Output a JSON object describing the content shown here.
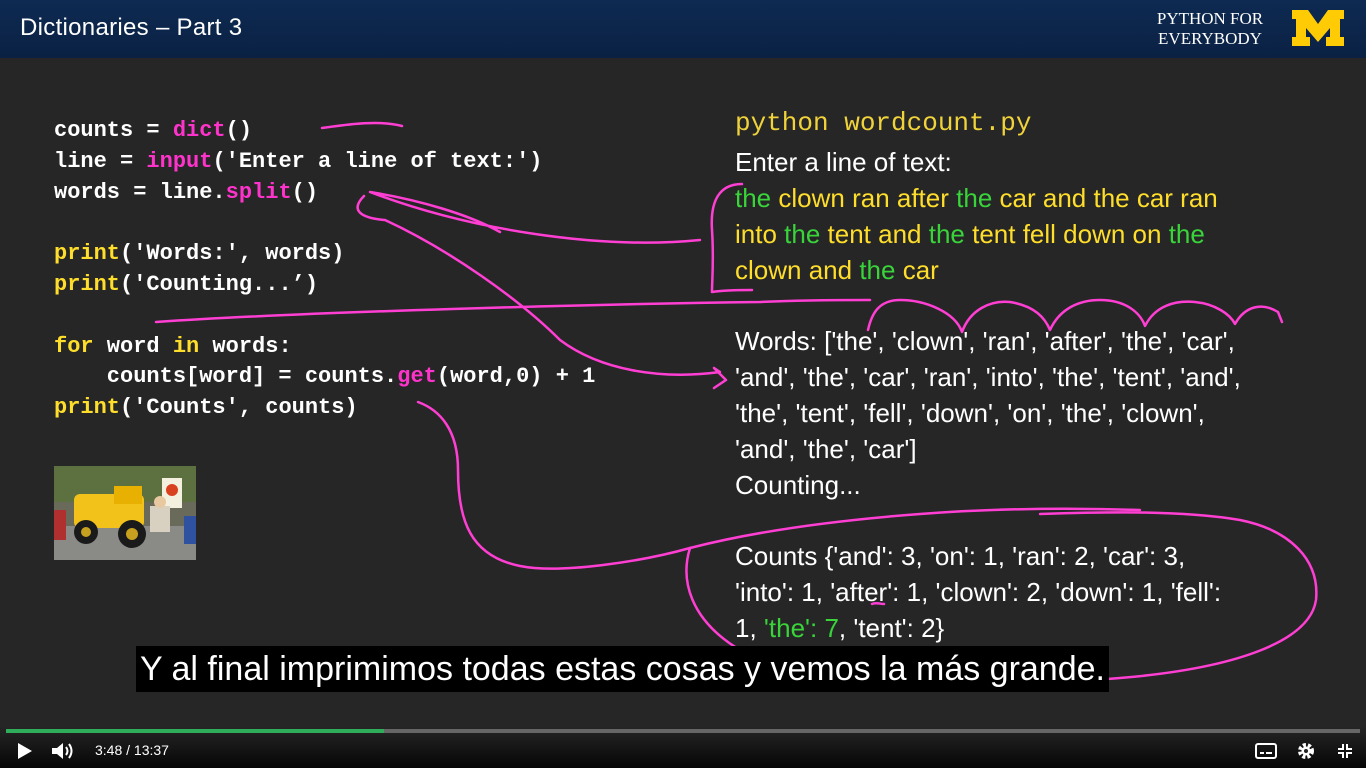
{
  "header": {
    "title": "Dictionaries – Part 3",
    "brand_line1": "PYTHON FOR",
    "brand_line2": "EVERYBODY",
    "logo_text": "M"
  },
  "code": [
    [
      {
        "t": "counts = ",
        "c": "w"
      },
      {
        "t": "dict",
        "c": "fn"
      },
      {
        "t": "()",
        "c": "w"
      }
    ],
    [
      {
        "t": "line = ",
        "c": "w"
      },
      {
        "t": "input",
        "c": "fn"
      },
      {
        "t": "('Enter a line of text:')",
        "c": "w"
      }
    ],
    [
      {
        "t": "words = line.",
        "c": "w"
      },
      {
        "t": "split",
        "c": "fn"
      },
      {
        "t": "()",
        "c": "w"
      }
    ],
    [],
    [
      {
        "t": "print",
        "c": "kw"
      },
      {
        "t": "('Words:', words)",
        "c": "w"
      }
    ],
    [
      {
        "t": "print",
        "c": "kw"
      },
      {
        "t": "('Counting...’)",
        "c": "w"
      }
    ],
    [],
    [
      {
        "t": "for",
        "c": "kw"
      },
      {
        "t": " word ",
        "c": "w"
      },
      {
        "t": "in",
        "c": "kw"
      },
      {
        "t": " words:",
        "c": "w"
      }
    ],
    [
      {
        "t": "    counts[word] = counts.",
        "c": "w"
      },
      {
        "t": "get",
        "c": "fn"
      },
      {
        "t": "(word,0) + 1",
        "c": "w"
      }
    ],
    [
      {
        "t": "print",
        "c": "kw"
      },
      {
        "t": "('Counts', counts)",
        "c": "w"
      }
    ]
  ],
  "terminal": {
    "command": "python wordcount.py",
    "prompt": "Enter a line of text:",
    "input_lines": [
      [
        {
          "t": "the",
          "c": "g"
        },
        {
          "t": " clown ran after ",
          "c": "y"
        },
        {
          "t": "the",
          "c": "g"
        },
        {
          "t": " car and the car ran",
          "c": "y"
        }
      ],
      [
        {
          "t": "into ",
          "c": "y"
        },
        {
          "t": "the",
          "c": "g"
        },
        {
          "t": " tent and ",
          "c": "y"
        },
        {
          "t": "the",
          "c": "g"
        },
        {
          "t": " tent fell down on ",
          "c": "y"
        },
        {
          "t": "the",
          "c": "g"
        }
      ],
      [
        {
          "t": "clown and ",
          "c": "y"
        },
        {
          "t": "the",
          "c": "g"
        },
        {
          "t": " car",
          "c": "y"
        }
      ]
    ],
    "words_lines": [
      "Words: ['the', 'clown', 'ran', 'after', 'the', 'car',",
      "'and', 'the', 'car', 'ran', 'into', 'the', 'tent', 'and',",
      "'the', 'tent', 'fell', 'down', 'on', 'the', 'clown',",
      "'and', 'the', 'car']",
      "Counting..."
    ],
    "counts_lines": [
      [
        {
          "t": "Counts {'and': 3, 'on': 1, 'ran': 2, 'car': 3,",
          "c": "w"
        }
      ],
      [
        {
          "t": "'into': 1, 'after': 1, 'clown': 2, 'down': 1, 'fell':",
          "c": "w"
        }
      ],
      [
        {
          "t": "1, ",
          "c": "w"
        },
        {
          "t": "'the': 7",
          "c": "g"
        },
        {
          "t": ", 'tent': 2}",
          "c": "w"
        }
      ]
    ]
  },
  "caption": "Y al final imprimimos todas estas cosas y vemos la más grande.",
  "player": {
    "current_time": "3:48",
    "separator": "/",
    "duration": "13:37",
    "progress_fraction": 0.279,
    "play_icon": "play-icon",
    "volume_icon": "volume-icon",
    "captions_icon": "captions-icon",
    "settings_icon": "gear-icon",
    "fullscreen_icon": "fullscreen-exit-icon"
  },
  "colors": {
    "header_bg": "#0a2143",
    "keyword": "#ffde2b",
    "function": "#ff33cc",
    "green": "#39d33a",
    "ink": "#ff3fd4",
    "progress": "#2fad5a",
    "maize": "#ffcb05"
  }
}
